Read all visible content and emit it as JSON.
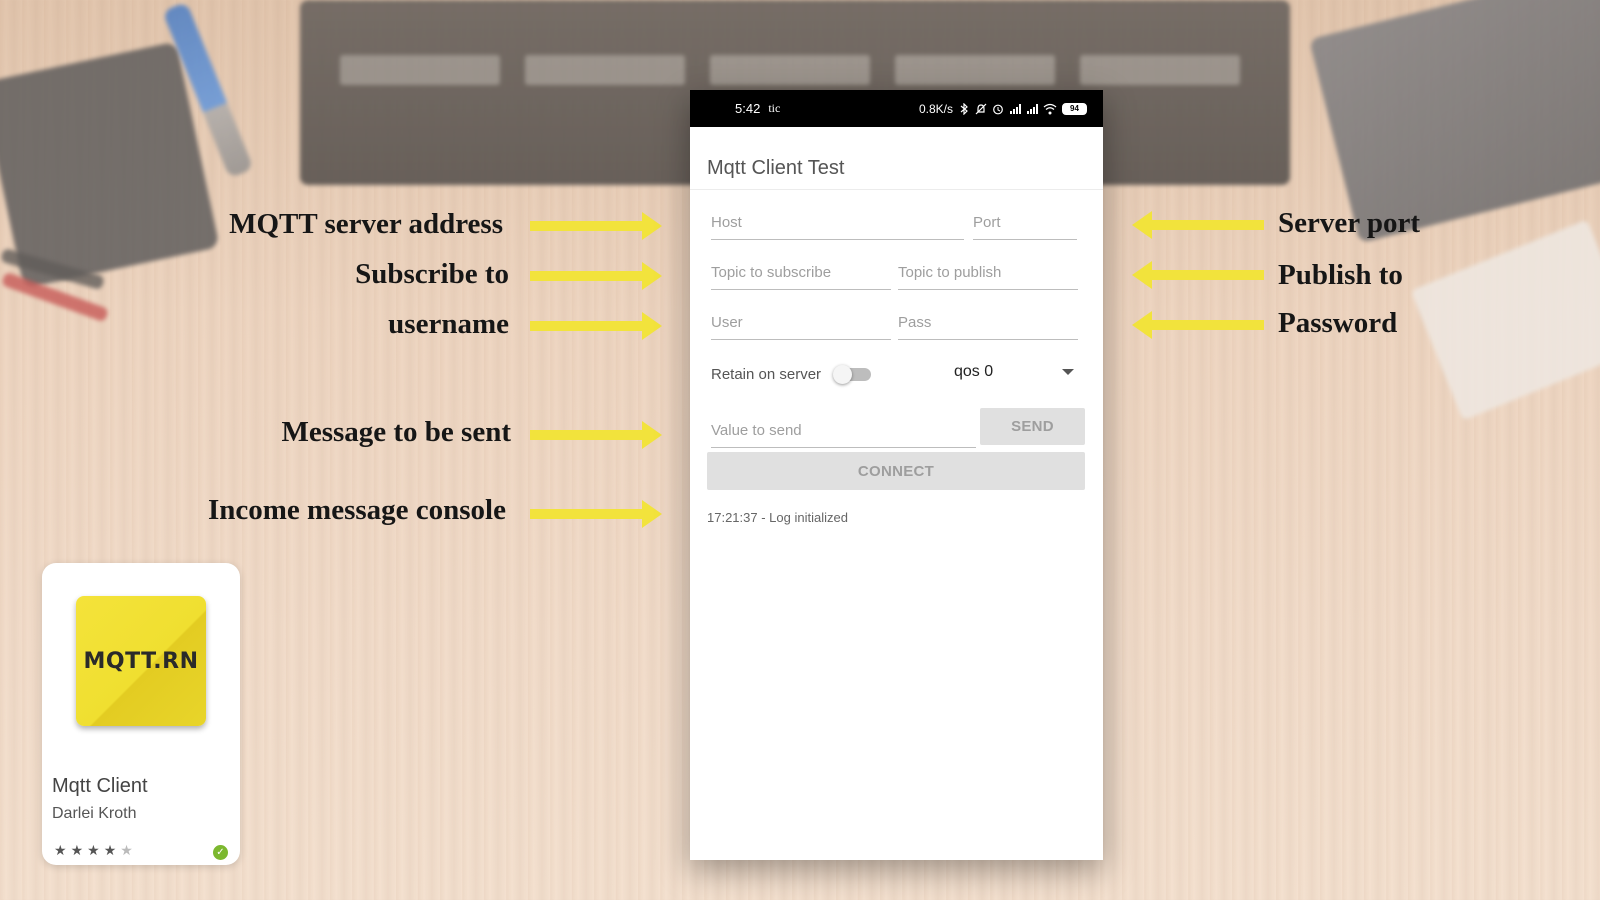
{
  "annotations": {
    "left": [
      {
        "text": "MQTT server address"
      },
      {
        "text": "Subscribe to"
      },
      {
        "text": "username"
      },
      {
        "text": "Message to be sent"
      },
      {
        "text": "Income message console"
      }
    ],
    "right": [
      {
        "text": "Server port"
      },
      {
        "text": "Publish to"
      },
      {
        "text": "Password"
      }
    ],
    "arrow_color": "#f2e33c"
  },
  "statusbar": {
    "time": "5:42",
    "carrier": "tic",
    "speed": "0.8K/s",
    "battery": "94",
    "icons": [
      "bluetooth-icon",
      "mute-icon",
      "alarm-icon",
      "signal-icon",
      "signal-icon",
      "wifi-icon",
      "battery-icon"
    ]
  },
  "app": {
    "title": "Mqtt Client Test",
    "host_placeholder": "Host",
    "port_placeholder": "Port",
    "subscribe_placeholder": "Topic to subscribe",
    "publish_placeholder": "Topic to publish",
    "user_placeholder": "User",
    "pass_placeholder": "Pass",
    "retain_label": "Retain on server",
    "retain_on": false,
    "qos_selected": "qos 0",
    "value_placeholder": "Value to send",
    "send_label": "SEND",
    "connect_label": "CONNECT",
    "log_line": "17:21:37 - Log initialized"
  },
  "store_card": {
    "logo_text": "MQTT.RN",
    "logo_color": "#f2e33c",
    "app_name": "Mqtt Client",
    "developer": "Darlei Kroth",
    "rating": 4.5,
    "verified_color": "#7cb82f"
  }
}
